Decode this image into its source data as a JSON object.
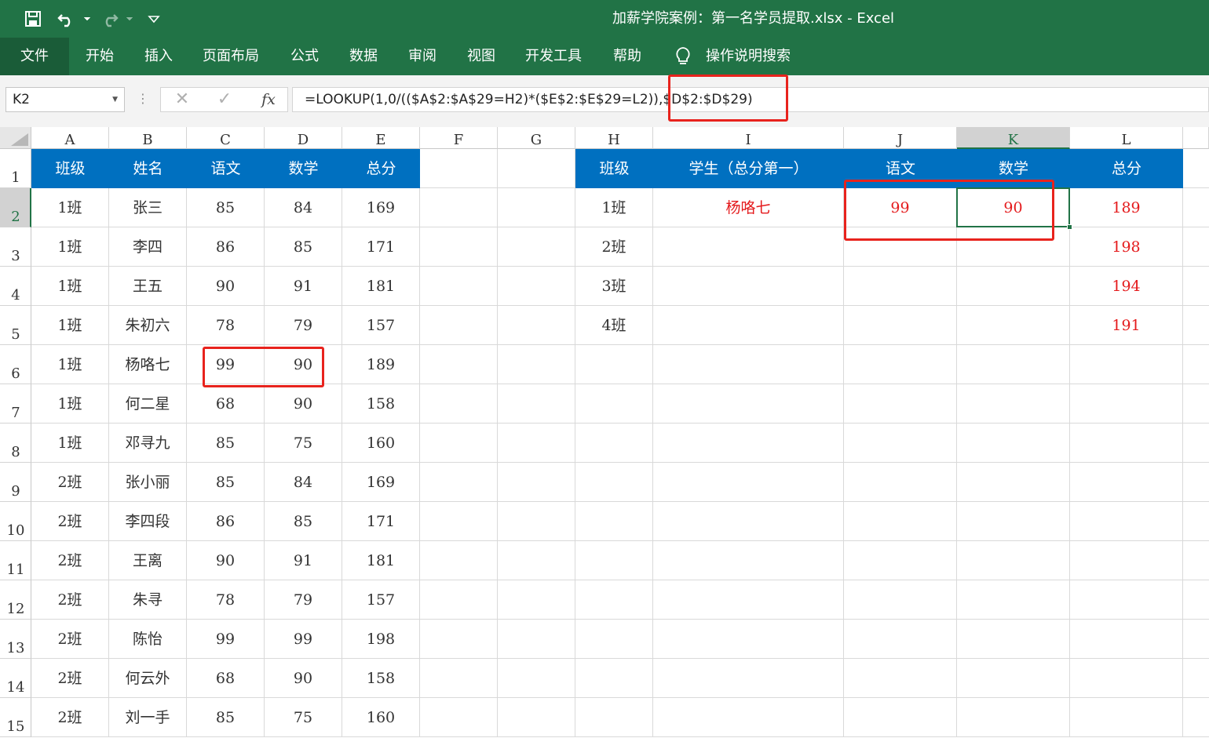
{
  "window": {
    "title": "加薪学院案例：第一名学员提取.xlsx  -  Excel",
    "quick_access": [
      {
        "name": "save-icon",
        "glyph": "save"
      },
      {
        "name": "undo-icon",
        "glyph": "undo"
      },
      {
        "name": "redo-icon",
        "glyph": "redo"
      },
      {
        "name": "customize-qat-icon",
        "glyph": "chevron-down"
      }
    ]
  },
  "ribbon": {
    "tabs": [
      "文件",
      "开始",
      "插入",
      "页面布局",
      "公式",
      "数据",
      "审阅",
      "视图",
      "开发工具",
      "帮助"
    ],
    "tell_me_icon": "lightbulb-icon",
    "tell_me": "操作说明搜索"
  },
  "formula_bar": {
    "name_box": "K2",
    "cancel_icon": "close-icon",
    "enter_icon": "check-icon",
    "fx_label": "fx",
    "formula": "=LOOKUP(1,0/(($A$2:$A$29=H2)*($E$2:$E$29=L2)),$D$2:$D$29)"
  },
  "sheet": {
    "columns": [
      "A",
      "B",
      "C",
      "D",
      "E",
      "F",
      "G",
      "H",
      "I",
      "J",
      "K",
      "L"
    ],
    "selected_column": "K",
    "selected_row": "2",
    "active_cell": "K2",
    "rows": [
      "1",
      "2",
      "3",
      "4",
      "5",
      "6",
      "7",
      "8",
      "9",
      "10",
      "11",
      "12",
      "13",
      "14",
      "15"
    ],
    "left_table": {
      "headers": [
        "班级",
        "姓名",
        "语文",
        "数学",
        "总分"
      ],
      "records": [
        [
          "1班",
          "张三",
          "85",
          "84",
          "169"
        ],
        [
          "1班",
          "李四",
          "86",
          "85",
          "171"
        ],
        [
          "1班",
          "王五",
          "90",
          "91",
          "181"
        ],
        [
          "1班",
          "朱初六",
          "78",
          "79",
          "157"
        ],
        [
          "1班",
          "杨咯七",
          "99",
          "90",
          "189"
        ],
        [
          "1班",
          "何二星",
          "68",
          "90",
          "158"
        ],
        [
          "1班",
          "邓寻九",
          "85",
          "75",
          "160"
        ],
        [
          "2班",
          "张小丽",
          "85",
          "84",
          "169"
        ],
        [
          "2班",
          "李四段",
          "86",
          "85",
          "171"
        ],
        [
          "2班",
          "王离",
          "90",
          "91",
          "181"
        ],
        [
          "2班",
          "朱寻",
          "78",
          "79",
          "157"
        ],
        [
          "2班",
          "陈怡",
          "99",
          "99",
          "198"
        ],
        [
          "2班",
          "何云外",
          "68",
          "90",
          "158"
        ],
        [
          "2班",
          "刘一手",
          "85",
          "75",
          "160"
        ]
      ]
    },
    "right_table": {
      "headers": [
        "班级",
        "学生（总分第一）",
        "语文",
        "数学",
        "总分"
      ],
      "records": [
        [
          "1班",
          "杨咯七",
          "99",
          "90",
          "189"
        ],
        [
          "2班",
          "",
          "",
          "",
          "198"
        ],
        [
          "3班",
          "",
          "",
          "",
          "194"
        ],
        [
          "4班",
          "",
          "",
          "",
          "191"
        ]
      ]
    },
    "colors": {
      "header_fill": "#0070c0",
      "result_text": "#e41a1c",
      "highlight_box": "#e8231d",
      "excel_green": "#217346"
    }
  }
}
